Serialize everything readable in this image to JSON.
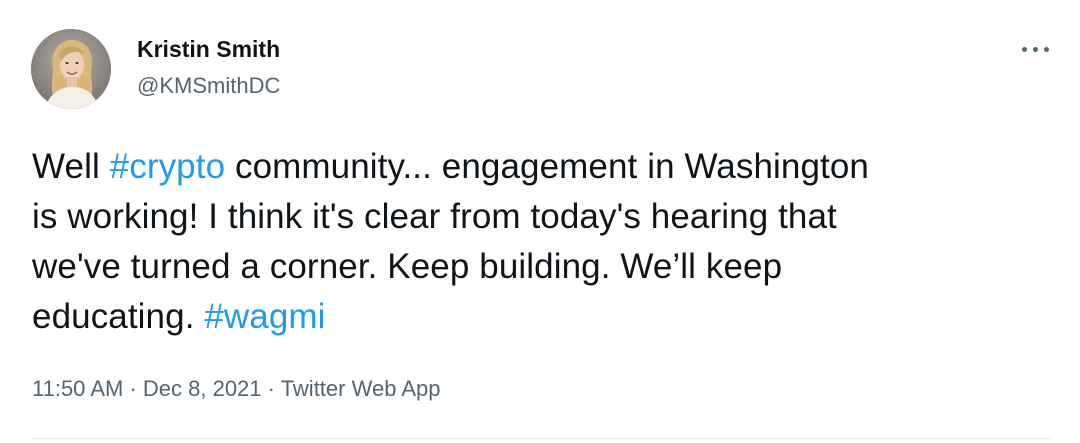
{
  "author": {
    "name": "Kristin Smith",
    "handle": "@KMSmithDC",
    "avatar_icon": "profile-photo"
  },
  "more_icon": "more-options-icon",
  "tweet": {
    "lines": [
      {
        "segments": [
          {
            "text": "Well ",
            "type": "text"
          },
          {
            "text": "#crypto",
            "type": "hashtag"
          },
          {
            "text": " community... engagement in Washington",
            "type": "text"
          }
        ]
      },
      {
        "segments": [
          {
            "text": "is working! I think it's clear from today's hearing that",
            "type": "text"
          }
        ]
      },
      {
        "segments": [
          {
            "text": "we've turned a corner. Keep building. We’ll keep",
            "type": "text"
          }
        ]
      },
      {
        "segments": [
          {
            "text": "educating. ",
            "type": "text"
          },
          {
            "text": "#wagmi",
            "type": "hashtag"
          }
        ]
      }
    ]
  },
  "meta": {
    "time": "11:50 AM",
    "separator": " · ",
    "date": "Dec 8, 2021",
    "source": "Twitter Web App"
  },
  "colors": {
    "text": "#0f1419",
    "secondary": "#536471",
    "link": "#1d9bf0",
    "divider": "#e6ecf0"
  }
}
